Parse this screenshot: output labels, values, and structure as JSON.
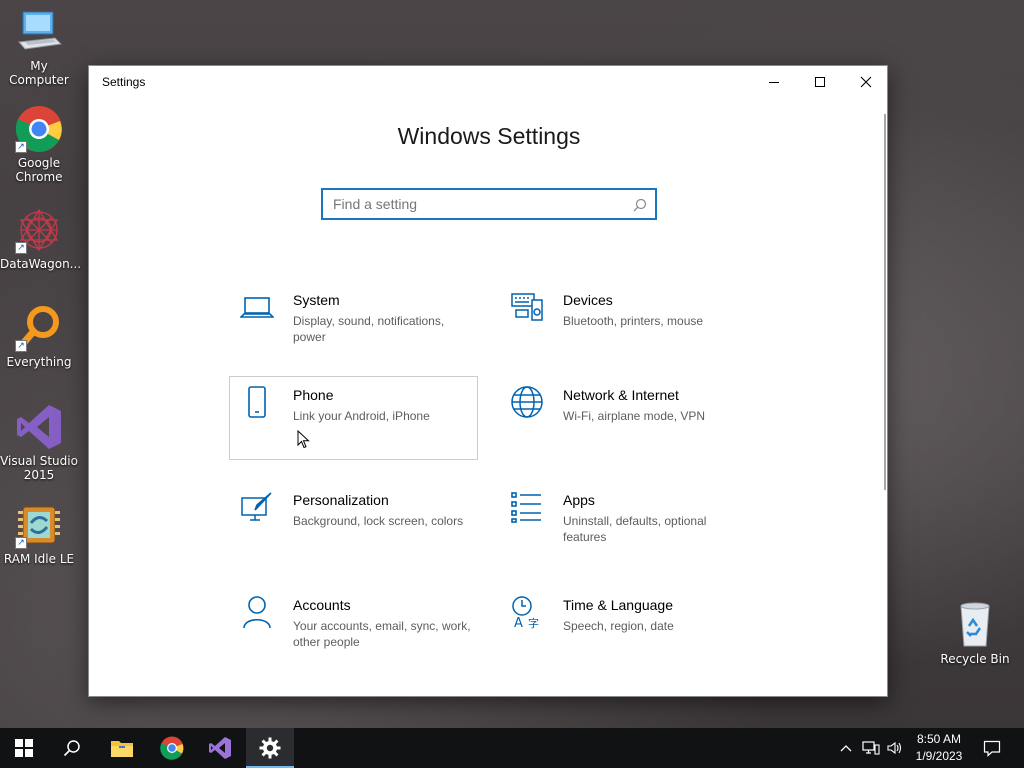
{
  "desktop": {
    "icons": [
      {
        "label": "My Computer"
      },
      {
        "label": "Google Chrome"
      },
      {
        "label": "DataWagon..."
      },
      {
        "label": "Everything"
      },
      {
        "label": "Visual Studio 2015"
      },
      {
        "label": "RAM Idle LE"
      }
    ],
    "recycle_bin": "Recycle Bin"
  },
  "window": {
    "title": "Settings",
    "heading": "Windows Settings",
    "search_placeholder": "Find a setting",
    "accent": "#0063b1"
  },
  "tiles": [
    {
      "name": "System",
      "desc": "Display, sound, notifications, power",
      "icon": "laptop-icon"
    },
    {
      "name": "Devices",
      "desc": "Bluetooth, printers, mouse",
      "icon": "devices-icon"
    },
    {
      "name": "Phone",
      "desc": "Link your Android, iPhone",
      "icon": "phone-icon"
    },
    {
      "name": "Network & Internet",
      "desc": "Wi-Fi, airplane mode, VPN",
      "icon": "globe-icon"
    },
    {
      "name": "Personalization",
      "desc": "Background, lock screen, colors",
      "icon": "personalization-icon"
    },
    {
      "name": "Apps",
      "desc": "Uninstall, defaults, optional features",
      "icon": "apps-list-icon"
    },
    {
      "name": "Accounts",
      "desc": "Your accounts, email, sync, work, other people",
      "icon": "person-icon"
    },
    {
      "name": "Time & Language",
      "desc": "Speech, region, date",
      "icon": "time-language-icon"
    }
  ],
  "taskbar": {
    "time": "8:50 AM",
    "date": "1/9/2023"
  }
}
